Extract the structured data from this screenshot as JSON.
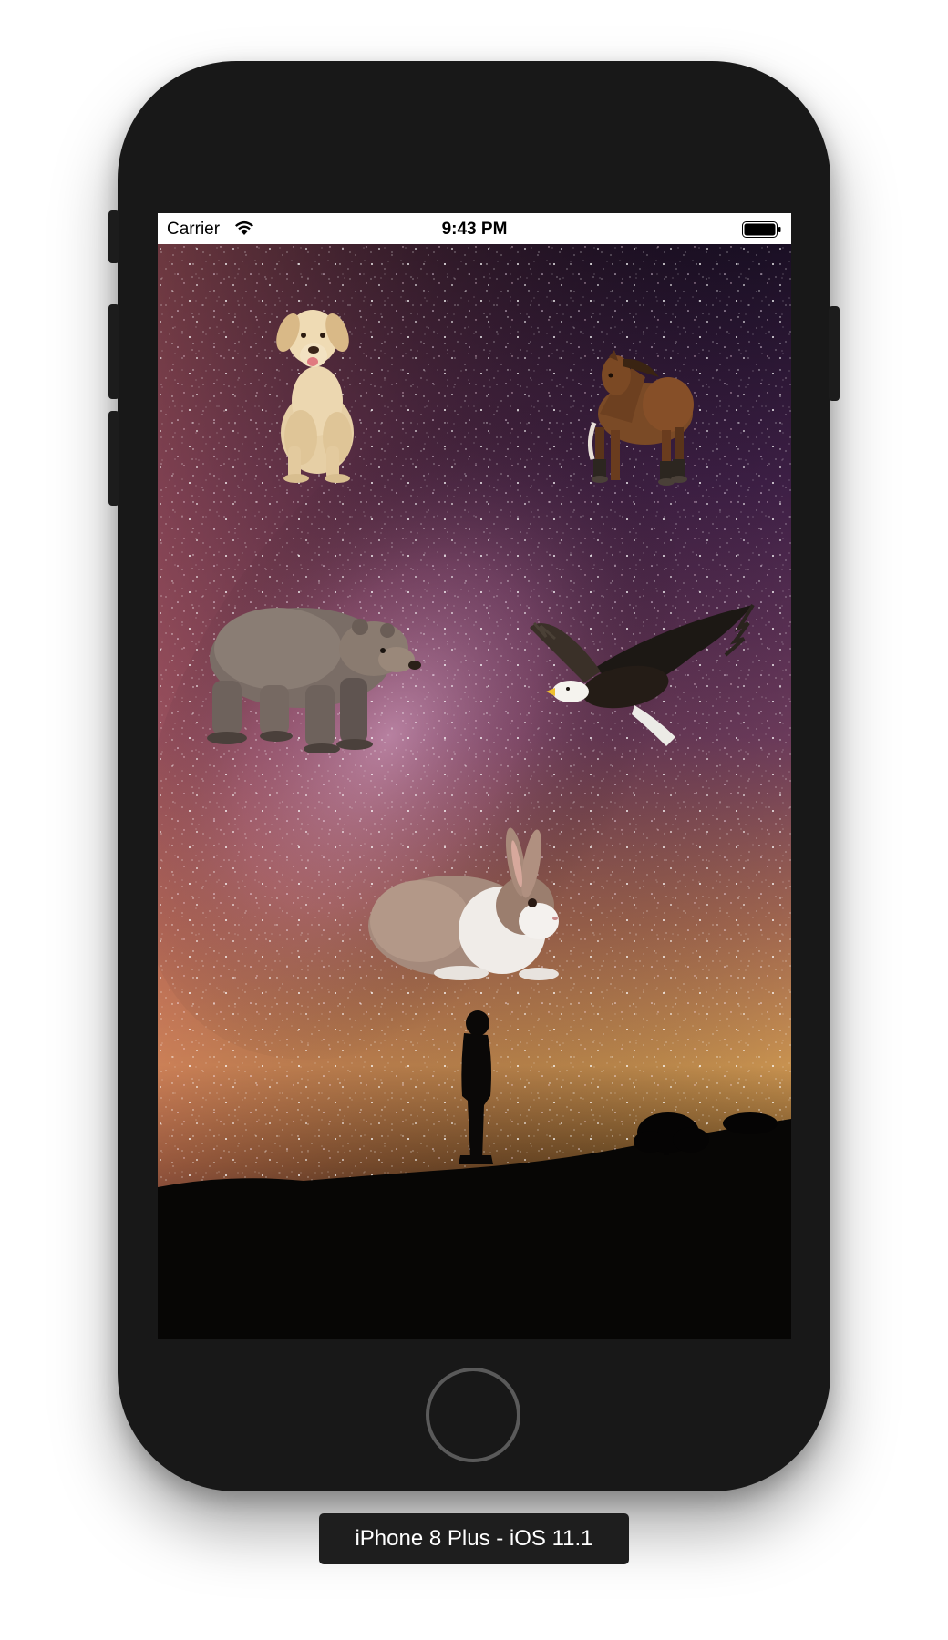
{
  "status_bar": {
    "carrier": "Carrier",
    "time": "9:43 PM",
    "wifi_icon": "wifi-icon",
    "battery_icon": "battery-full-icon"
  },
  "scene": {
    "background": "night sky with milky way and silhouette of person on hill",
    "animals": [
      {
        "name": "dog",
        "icon": "dog-image"
      },
      {
        "name": "horse",
        "icon": "horse-image"
      },
      {
        "name": "bear",
        "icon": "bear-image"
      },
      {
        "name": "eagle",
        "icon": "eagle-image"
      },
      {
        "name": "rabbit",
        "icon": "rabbit-image"
      }
    ]
  },
  "device": {
    "label": "iPhone 8 Plus - iOS 11.1",
    "frame_color": "#181818"
  }
}
